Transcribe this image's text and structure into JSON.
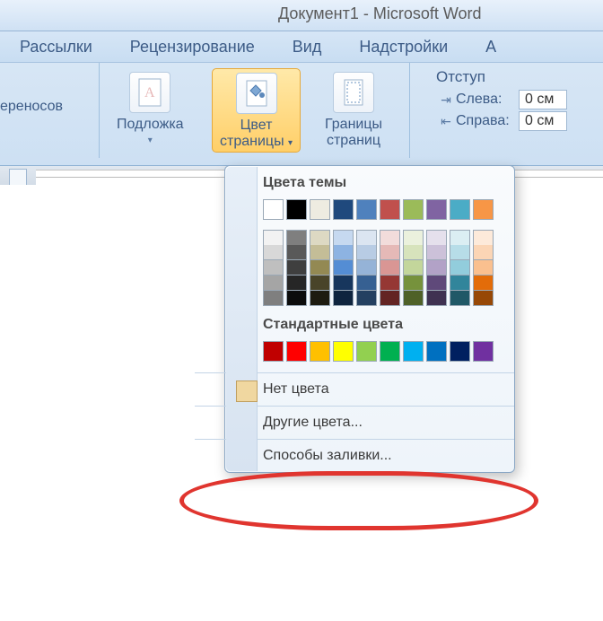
{
  "titlebar": {
    "text": "Документ1 - Microsoft Word"
  },
  "tabs": {
    "mailings": "Рассылки",
    "review": "Рецензирование",
    "view": "Вид",
    "addins": "Надстройки",
    "partial": "А"
  },
  "ribbon": {
    "hyphen_fragment": "ереносов",
    "watermark": "Подложка",
    "page_color_line1": "Цвет",
    "page_color_line2": "страницы",
    "page_borders_line1": "Границы",
    "page_borders_line2": "страниц",
    "indent": {
      "title": "Отступ",
      "left_label": "Слева:",
      "right_label": "Справа:",
      "left_value": "0 см",
      "right_value": "0 см"
    }
  },
  "dropdown": {
    "theme_heading": "Цвета темы",
    "standard_heading": "Стандартные цвета",
    "no_color": "Нет цвета",
    "more_colors": "Другие цвета...",
    "fill_effects": "Способы заливки...",
    "recent_chip": "#f0d7a0",
    "theme_row": [
      "#ffffff",
      "#000000",
      "#eeece1",
      "#1f497d",
      "#4f81bd",
      "#c0504d",
      "#9bbb59",
      "#8064a2",
      "#4bacc6",
      "#f79646"
    ],
    "theme_shades": [
      [
        "#f2f2f2",
        "#7f7f7f",
        "#ddd9c3",
        "#c6d9f0",
        "#dbe5f1",
        "#f2dcdb",
        "#ebf1dd",
        "#e5e0ec",
        "#dbeef3",
        "#fdeada"
      ],
      [
        "#d8d8d8",
        "#595959",
        "#c4bd97",
        "#8db3e2",
        "#b8cce4",
        "#e5b9b7",
        "#d7e3bc",
        "#ccc1d9",
        "#b7dde8",
        "#fbd5b5"
      ],
      [
        "#bfbfbf",
        "#3f3f3f",
        "#938953",
        "#548dd4",
        "#95b3d7",
        "#d99694",
        "#c3d69b",
        "#b2a2c7",
        "#92cddc",
        "#fac08f"
      ],
      [
        "#a5a5a5",
        "#262626",
        "#494429",
        "#17365d",
        "#366092",
        "#953734",
        "#76923c",
        "#5f497a",
        "#31859b",
        "#e36c09"
      ],
      [
        "#7f7f7f",
        "#0c0c0c",
        "#1d1b10",
        "#0f243e",
        "#244061",
        "#632423",
        "#4f6128",
        "#3f3151",
        "#205867",
        "#974806"
      ]
    ],
    "standard_row": [
      "#c00000",
      "#ff0000",
      "#ffc000",
      "#ffff00",
      "#92d050",
      "#00b050",
      "#00b0f0",
      "#0070c0",
      "#002060",
      "#7030a0"
    ]
  }
}
